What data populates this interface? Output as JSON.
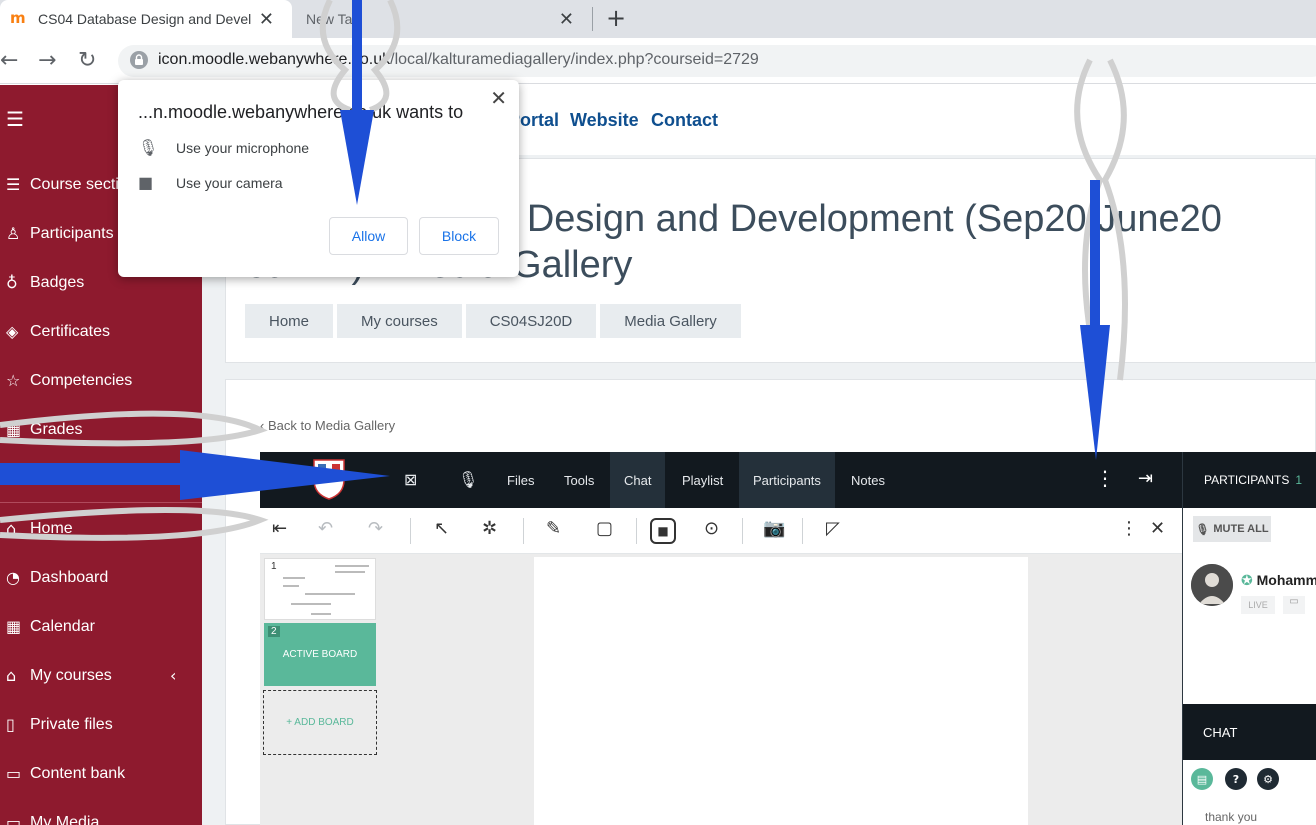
{
  "browser": {
    "tabs": [
      {
        "title": "CS04 Database Design and Devel",
        "active": true
      },
      {
        "title": "New Ta",
        "active": false
      }
    ],
    "url_host": "icon.moodle.webanywhere.co.uk",
    "url_path": "/local/kalturamediagallery/index.php?courseid=2729"
  },
  "permission_popup": {
    "title": "...n.moodle.webanywhere.co.uk wants to",
    "items": [
      "Use your microphone",
      "Use your camera"
    ],
    "allow_label": "Allow",
    "block_label": "Block"
  },
  "sidebar": {
    "items": [
      {
        "label": "Course sections",
        "icon": "list-icon"
      },
      {
        "label": "Participants",
        "icon": "users-icon"
      },
      {
        "label": "Badges",
        "icon": "badge-icon"
      },
      {
        "label": "Certificates",
        "icon": "layers-icon"
      },
      {
        "label": "Competencies",
        "icon": "star-icon"
      },
      {
        "label": "Grades",
        "icon": "table-icon"
      },
      {
        "label": "Home",
        "icon": "home-icon"
      },
      {
        "label": "Dashboard",
        "icon": "dashboard-icon"
      },
      {
        "label": "Calendar",
        "icon": "calendar-icon"
      },
      {
        "label": "My courses",
        "icon": "graduation-cap-icon"
      },
      {
        "label": "Private files",
        "icon": "file-icon"
      },
      {
        "label": "Content bank",
        "icon": "clipboard-icon"
      },
      {
        "label": "My Media",
        "icon": "folder-icon"
      }
    ]
  },
  "topnav": [
    "Portal",
    "Website",
    "Contact"
  ],
  "page": {
    "title_line1": "CS04 Database Design and Development (Sep20/June20",
    "title_line2": "Jan21) - Media Gallery",
    "breadcrumb": [
      "Home",
      "My courses",
      "CS04SJ20D",
      "Media Gallery"
    ],
    "back_link": "Back to Media Gallery"
  },
  "room": {
    "menu": [
      "Files",
      "Tools",
      "Chat",
      "Playlist",
      "Participants",
      "Notes"
    ],
    "participants_label": "PARTICIPANTS",
    "participants_count": "1",
    "mute_all": "MUTE ALL",
    "participant_name": "Mohammed",
    "live_label": "LIVE",
    "chat_label": "CHAT",
    "chat_message": "thank you",
    "boards": [
      {
        "num": "1",
        "label": ""
      },
      {
        "num": "2",
        "label": "ACTIVE BOARD"
      }
    ],
    "add_board": "+ ADD BOARD"
  },
  "colors": {
    "sidebar": "#8e1a2e",
    "room_bar": "#12191f",
    "accent_green": "#5ab89a",
    "link_blue": "#0f4f8f"
  }
}
